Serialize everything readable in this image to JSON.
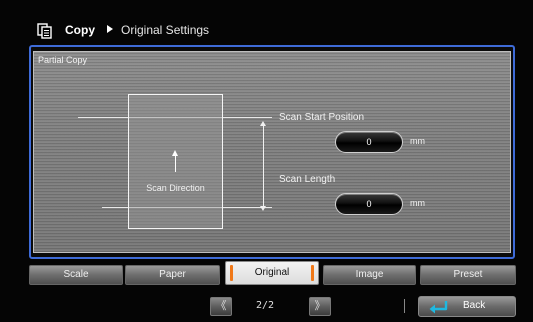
{
  "header": {
    "title": "Copy",
    "breadcrumb": "Original Settings",
    "icon": "copy-icon"
  },
  "panel": {
    "section_label": "Partial Copy",
    "scan_direction_label": "Scan Direction",
    "scan_start_position": {
      "label": "Scan Start Position",
      "value": "0",
      "unit": "mm"
    },
    "scan_length": {
      "label": "Scan Length",
      "value": "0",
      "unit": "mm"
    }
  },
  "tabs": [
    {
      "label": "Scale",
      "active": false
    },
    {
      "label": "Paper",
      "active": false
    },
    {
      "label": "Original",
      "active": true
    },
    {
      "label": "Image",
      "active": false
    },
    {
      "label": "Preset",
      "active": false
    }
  ],
  "footer": {
    "prev_label": "《",
    "next_label": "》",
    "page_indicator": "2/2",
    "back_label": "Back"
  },
  "colors": {
    "panel_border_accent": "#3e6bd8",
    "active_tab_bracket": "#f07818",
    "back_icon": "#1fb8e0"
  }
}
